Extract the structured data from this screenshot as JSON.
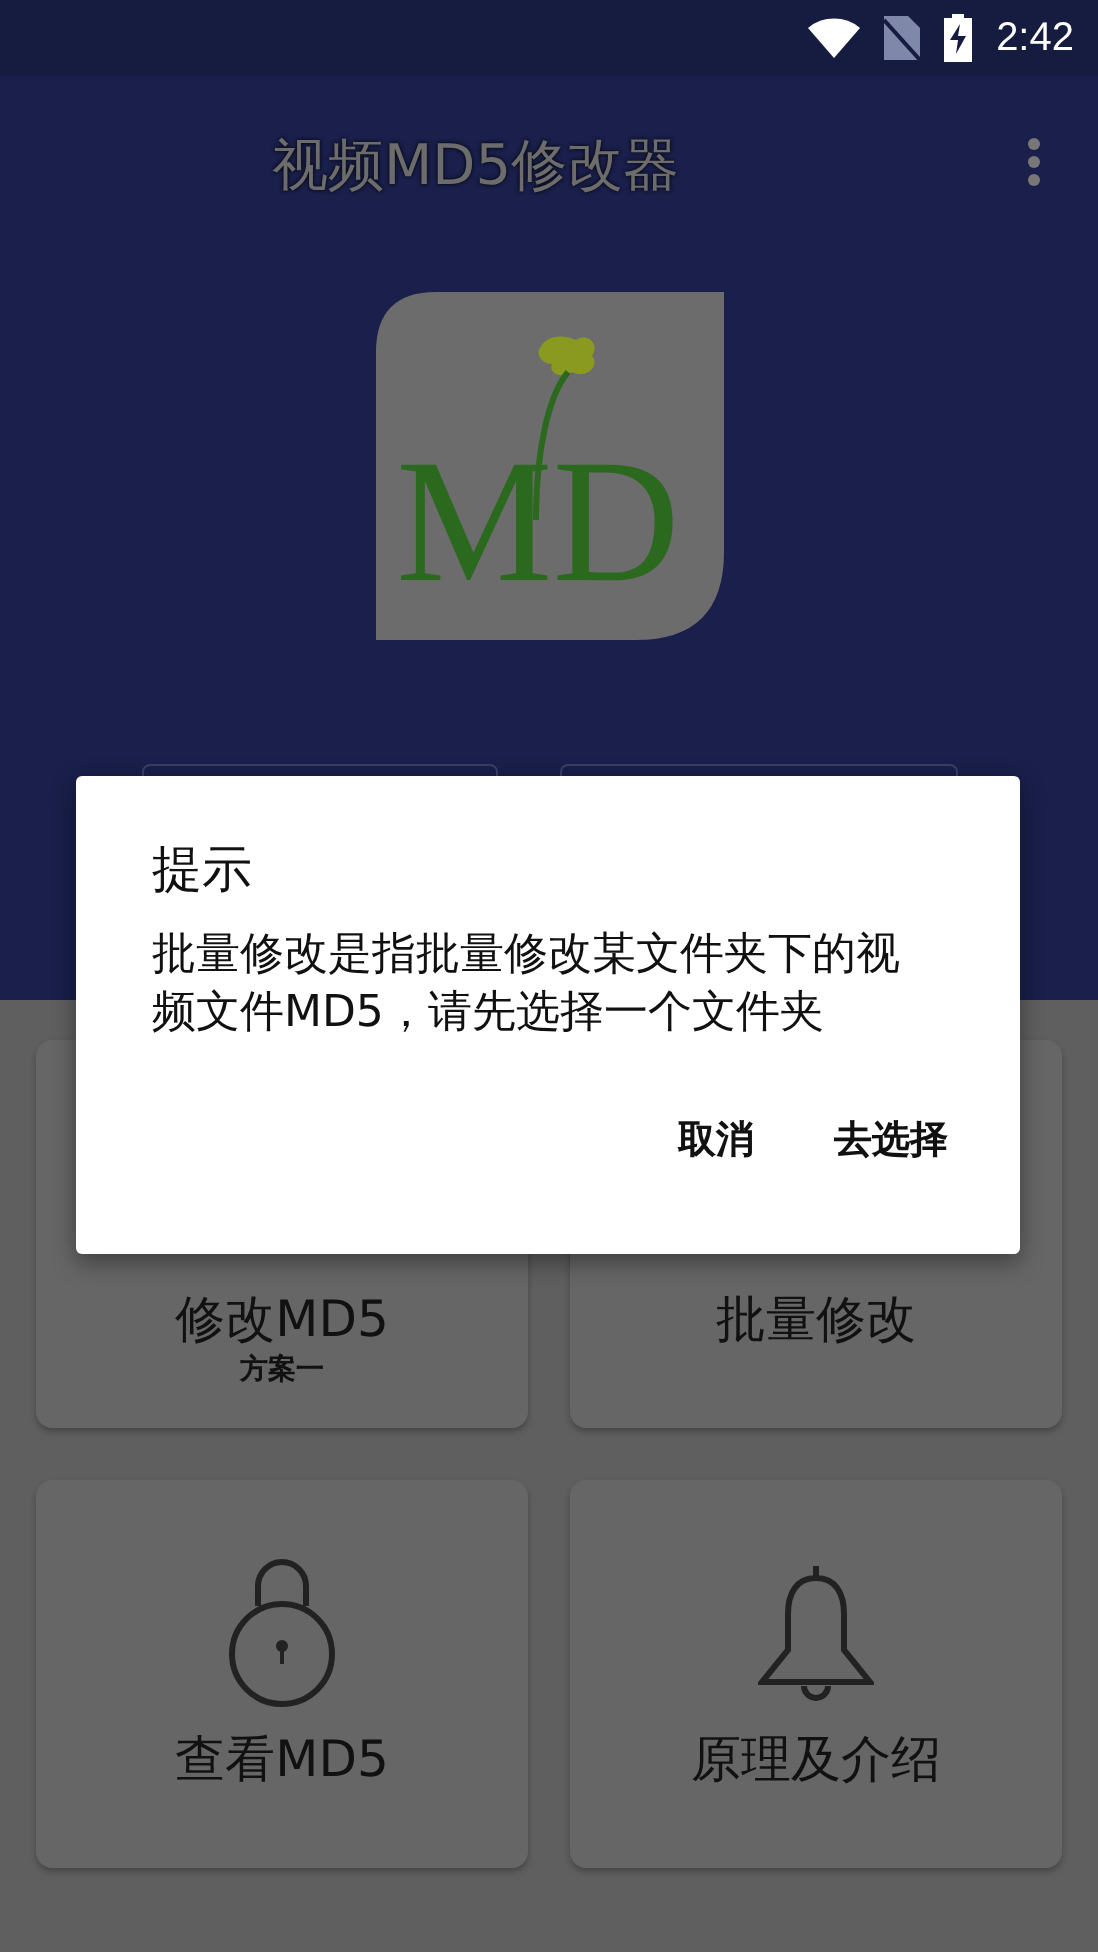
{
  "status_bar": {
    "time": "2:42"
  },
  "app_bar": {
    "title": "视频MD5修改器"
  },
  "logo": {
    "text": "MD"
  },
  "cards": [
    {
      "label": "修改MD5",
      "sublabel": "方案一"
    },
    {
      "label": "批量修改"
    },
    {
      "label": "查看MD5"
    },
    {
      "label": "原理及介绍"
    }
  ],
  "dialog": {
    "title": "提示",
    "message": "批量修改是指批量修改某文件夹下的视频文件MD5，请先选择一个文件夹",
    "buttons": [
      "取消",
      "去选择"
    ]
  }
}
